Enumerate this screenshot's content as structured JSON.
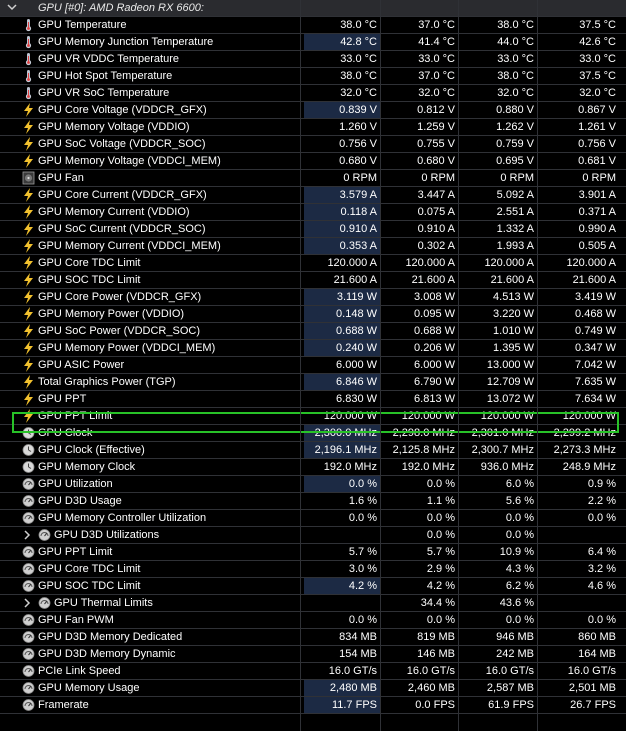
{
  "group": {
    "title": "GPU [#0]: AMD Radeon RX 6600:",
    "rows": [
      {
        "icon": "thermometer-icon",
        "label": "GPU Temperature",
        "values": [
          "38.0 °C",
          "37.0 °C",
          "38.0 °C",
          "37.5 °C"
        ],
        "hl": false
      },
      {
        "icon": "thermometer-icon",
        "label": "GPU Memory Junction Temperature",
        "values": [
          "42.8 °C",
          "41.4 °C",
          "44.0 °C",
          "42.6 °C"
        ],
        "hl": true
      },
      {
        "icon": "thermometer-icon",
        "label": "GPU VR VDDC Temperature",
        "values": [
          "33.0 °C",
          "33.0 °C",
          "33.0 °C",
          "33.0 °C"
        ],
        "hl": false
      },
      {
        "icon": "thermometer-icon",
        "label": "GPU Hot Spot Temperature",
        "values": [
          "38.0 °C",
          "37.0 °C",
          "38.0 °C",
          "37.5 °C"
        ],
        "hl": false
      },
      {
        "icon": "thermometer-icon",
        "label": "GPU VR SoC Temperature",
        "values": [
          "32.0 °C",
          "32.0 °C",
          "32.0 °C",
          "32.0 °C"
        ],
        "hl": false
      },
      {
        "icon": "lightning-icon",
        "label": "GPU Core Voltage (VDDCR_GFX)",
        "values": [
          "0.839 V",
          "0.812 V",
          "0.880 V",
          "0.867 V"
        ],
        "hl": true
      },
      {
        "icon": "lightning-icon",
        "label": "GPU Memory Voltage (VDDIO)",
        "values": [
          "1.260 V",
          "1.259 V",
          "1.262 V",
          "1.261 V"
        ],
        "hl": false
      },
      {
        "icon": "lightning-icon",
        "label": "GPU SoC Voltage (VDDCR_SOC)",
        "values": [
          "0.756 V",
          "0.755 V",
          "0.759 V",
          "0.756 V"
        ],
        "hl": false
      },
      {
        "icon": "lightning-icon",
        "label": "GPU Memory Voltage (VDDCI_MEM)",
        "values": [
          "0.680 V",
          "0.680 V",
          "0.695 V",
          "0.681 V"
        ],
        "hl": false
      },
      {
        "icon": "fan-icon",
        "label": "GPU Fan",
        "values": [
          "0 RPM",
          "0 RPM",
          "0 RPM",
          "0 RPM"
        ],
        "hl": false
      },
      {
        "icon": "lightning-icon",
        "label": "GPU Core Current (VDDCR_GFX)",
        "values": [
          "3.579 A",
          "3.447 A",
          "5.092 A",
          "3.901 A"
        ],
        "hl": true
      },
      {
        "icon": "lightning-icon",
        "label": "GPU Memory Current (VDDIO)",
        "values": [
          "0.118 A",
          "0.075 A",
          "2.551 A",
          "0.371 A"
        ],
        "hl": true
      },
      {
        "icon": "lightning-icon",
        "label": "GPU SoC Current (VDDCR_SOC)",
        "values": [
          "0.910 A",
          "0.910 A",
          "1.332 A",
          "0.990 A"
        ],
        "hl": true
      },
      {
        "icon": "lightning-icon",
        "label": "GPU Memory Current (VDDCI_MEM)",
        "values": [
          "0.353 A",
          "0.302 A",
          "1.993 A",
          "0.505 A"
        ],
        "hl": true
      },
      {
        "icon": "lightning-icon",
        "label": "GPU Core TDC Limit",
        "values": [
          "120.000 A",
          "120.000 A",
          "120.000 A",
          "120.000 A"
        ],
        "hl": false
      },
      {
        "icon": "lightning-icon",
        "label": "GPU SOC TDC Limit",
        "values": [
          "21.600 A",
          "21.600 A",
          "21.600 A",
          "21.600 A"
        ],
        "hl": false
      },
      {
        "icon": "lightning-icon",
        "label": "GPU Core Power (VDDCR_GFX)",
        "values": [
          "3.119 W",
          "3.008 W",
          "4.513 W",
          "3.419 W"
        ],
        "hl": true
      },
      {
        "icon": "lightning-icon",
        "label": "GPU Memory Power (VDDIO)",
        "values": [
          "0.148 W",
          "0.095 W",
          "3.220 W",
          "0.468 W"
        ],
        "hl": true
      },
      {
        "icon": "lightning-icon",
        "label": "GPU SoC Power (VDDCR_SOC)",
        "values": [
          "0.688 W",
          "0.688 W",
          "1.010 W",
          "0.749 W"
        ],
        "hl": true
      },
      {
        "icon": "lightning-icon",
        "label": "GPU Memory Power (VDDCI_MEM)",
        "values": [
          "0.240 W",
          "0.206 W",
          "1.395 W",
          "0.347 W"
        ],
        "hl": true
      },
      {
        "icon": "lightning-icon",
        "label": "GPU ASIC Power",
        "values": [
          "6.000 W",
          "6.000 W",
          "13.000 W",
          "7.042 W"
        ],
        "hl": false
      },
      {
        "icon": "lightning-icon",
        "label": "Total Graphics Power (TGP)",
        "values": [
          "6.846 W",
          "6.790 W",
          "12.709 W",
          "7.635 W"
        ],
        "hl": true
      },
      {
        "icon": "lightning-icon",
        "label": "GPU PPT",
        "values": [
          "6.830 W",
          "6.813 W",
          "13.072 W",
          "7.634 W"
        ],
        "hl": false
      },
      {
        "icon": "lightning-icon",
        "label": "GPU PPT Limit",
        "values": [
          "120.000 W",
          "120.000 W",
          "120.000 W",
          "120.000 W"
        ],
        "hl": false
      },
      {
        "icon": "clock-icon",
        "label": "GPU Clock",
        "values": [
          "2,300.0 MHz",
          "2,298.0 MHz",
          "2,301.0 MHz",
          "2,299.2 MHz"
        ],
        "hl": true
      },
      {
        "icon": "clock-icon",
        "label": "GPU Clock (Effective)",
        "values": [
          "2,196.1 MHz",
          "2,125.8 MHz",
          "2,300.7 MHz",
          "2,273.3 MHz"
        ],
        "hl": true
      },
      {
        "icon": "clock-icon",
        "label": "GPU Memory Clock",
        "values": [
          "192.0 MHz",
          "192.0 MHz",
          "936.0 MHz",
          "248.9 MHz"
        ],
        "hl": false
      },
      {
        "icon": "gauge-icon",
        "label": "GPU Utilization",
        "values": [
          "0.0 %",
          "0.0 %",
          "6.0 %",
          "0.9 %"
        ],
        "hl": true
      },
      {
        "icon": "gauge-icon",
        "label": "GPU D3D Usage",
        "values": [
          "1.6 %",
          "1.1 %",
          "5.6 %",
          "2.2 %"
        ],
        "hl": false
      },
      {
        "icon": "gauge-icon",
        "label": "GPU Memory Controller Utilization",
        "values": [
          "0.0 %",
          "0.0 %",
          "0.0 %",
          "0.0 %"
        ],
        "hl": false
      },
      {
        "icon": "gauge-icon",
        "label": "GPU D3D Utilizations",
        "values": [
          "",
          "0.0 %",
          "0.0 %",
          ""
        ],
        "hl": false,
        "sub": true
      },
      {
        "icon": "gauge-icon",
        "label": "GPU PPT Limit",
        "values": [
          "5.7 %",
          "5.7 %",
          "10.9 %",
          "6.4 %"
        ],
        "hl": false
      },
      {
        "icon": "gauge-icon",
        "label": "GPU Core TDC Limit",
        "values": [
          "3.0 %",
          "2.9 %",
          "4.3 %",
          "3.2 %"
        ],
        "hl": false
      },
      {
        "icon": "gauge-icon",
        "label": "GPU SOC TDC Limit",
        "values": [
          "4.2 %",
          "4.2 %",
          "6.2 %",
          "4.6 %"
        ],
        "hl": true
      },
      {
        "icon": "gauge-icon",
        "label": "GPU Thermal Limits",
        "values": [
          "",
          "34.4 %",
          "43.6 %",
          ""
        ],
        "hl": false,
        "sub": true
      },
      {
        "icon": "gauge-icon",
        "label": "GPU Fan PWM",
        "values": [
          "0.0 %",
          "0.0 %",
          "0.0 %",
          "0.0 %"
        ],
        "hl": false
      },
      {
        "icon": "gauge-icon",
        "label": "GPU D3D Memory Dedicated",
        "values": [
          "834 MB",
          "819 MB",
          "946 MB",
          "860 MB"
        ],
        "hl": false
      },
      {
        "icon": "gauge-icon",
        "label": "GPU D3D Memory Dynamic",
        "values": [
          "154 MB",
          "146 MB",
          "242 MB",
          "164 MB"
        ],
        "hl": false
      },
      {
        "icon": "gauge-icon",
        "label": "PCIe Link Speed",
        "values": [
          "16.0 GT/s",
          "16.0 GT/s",
          "16.0 GT/s",
          "16.0 GT/s"
        ],
        "hl": false
      },
      {
        "icon": "gauge-icon",
        "label": "GPU Memory Usage",
        "values": [
          "2,480 MB",
          "2,460 MB",
          "2,587 MB",
          "2,501 MB"
        ],
        "hl": true
      },
      {
        "icon": "gauge-icon",
        "label": "Framerate",
        "values": [
          "11.7 FPS",
          "0.0 FPS",
          "61.9 FPS",
          "26.7 FPS"
        ],
        "hl": true
      }
    ]
  },
  "highlighted_row": "GPU PPT Limit",
  "colors": {
    "accent_box": "#28c228",
    "value_highlight": "#1c2a44",
    "background": "#000000"
  }
}
